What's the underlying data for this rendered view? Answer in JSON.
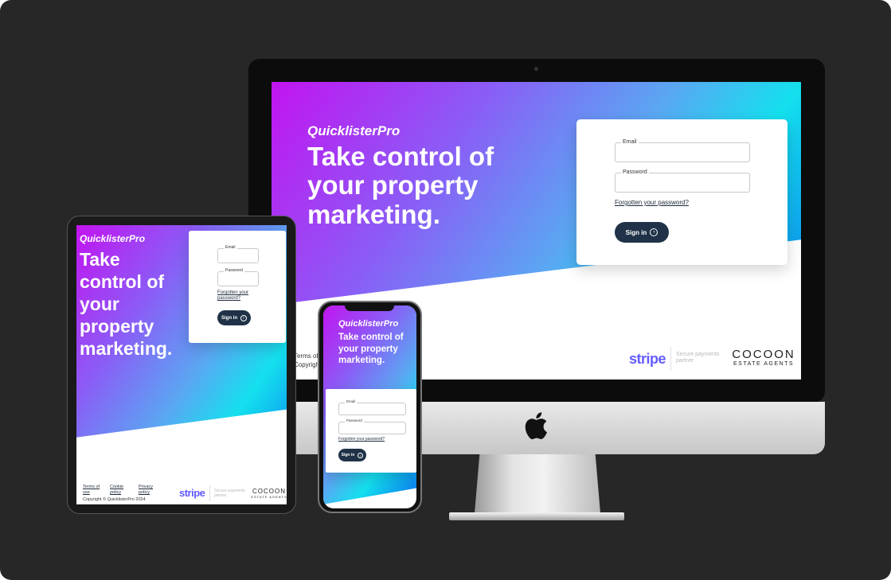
{
  "app": {
    "brand": "QuicklisterPro",
    "hero_desktop": "Take control of your property marketing.",
    "hero_tablet": "Take control of your property marketing.",
    "hero_phone": "Take control of your property marketing."
  },
  "login": {
    "email_label": "Email",
    "password_label": "Password",
    "forgot_link": "Forgotten your password?",
    "signin_button": "Sign in",
    "signin_icon": "arrow-circle-right-icon"
  },
  "footer": {
    "terms_link": "Terms of use",
    "cookie_link": "Cookie policy",
    "privacy_link": "Privacy policy",
    "copyright": "Copyright © QuicklisterPro 2024",
    "terms_partial": "Terms of",
    "copyright_partial": "Copyrigh"
  },
  "partners": {
    "stripe": "stripe",
    "secure_text": "Secure payments partner",
    "cocoon_name": "COCOON",
    "cocoon_sub": "ESTATE AGENTS"
  },
  "colors": {
    "gradient_start": "#c214f0",
    "gradient_mid": "#14e0ee",
    "gradient_end": "#0a6cf0",
    "button": "#1f3247",
    "stripe": "#635bff",
    "background": "#272727"
  }
}
